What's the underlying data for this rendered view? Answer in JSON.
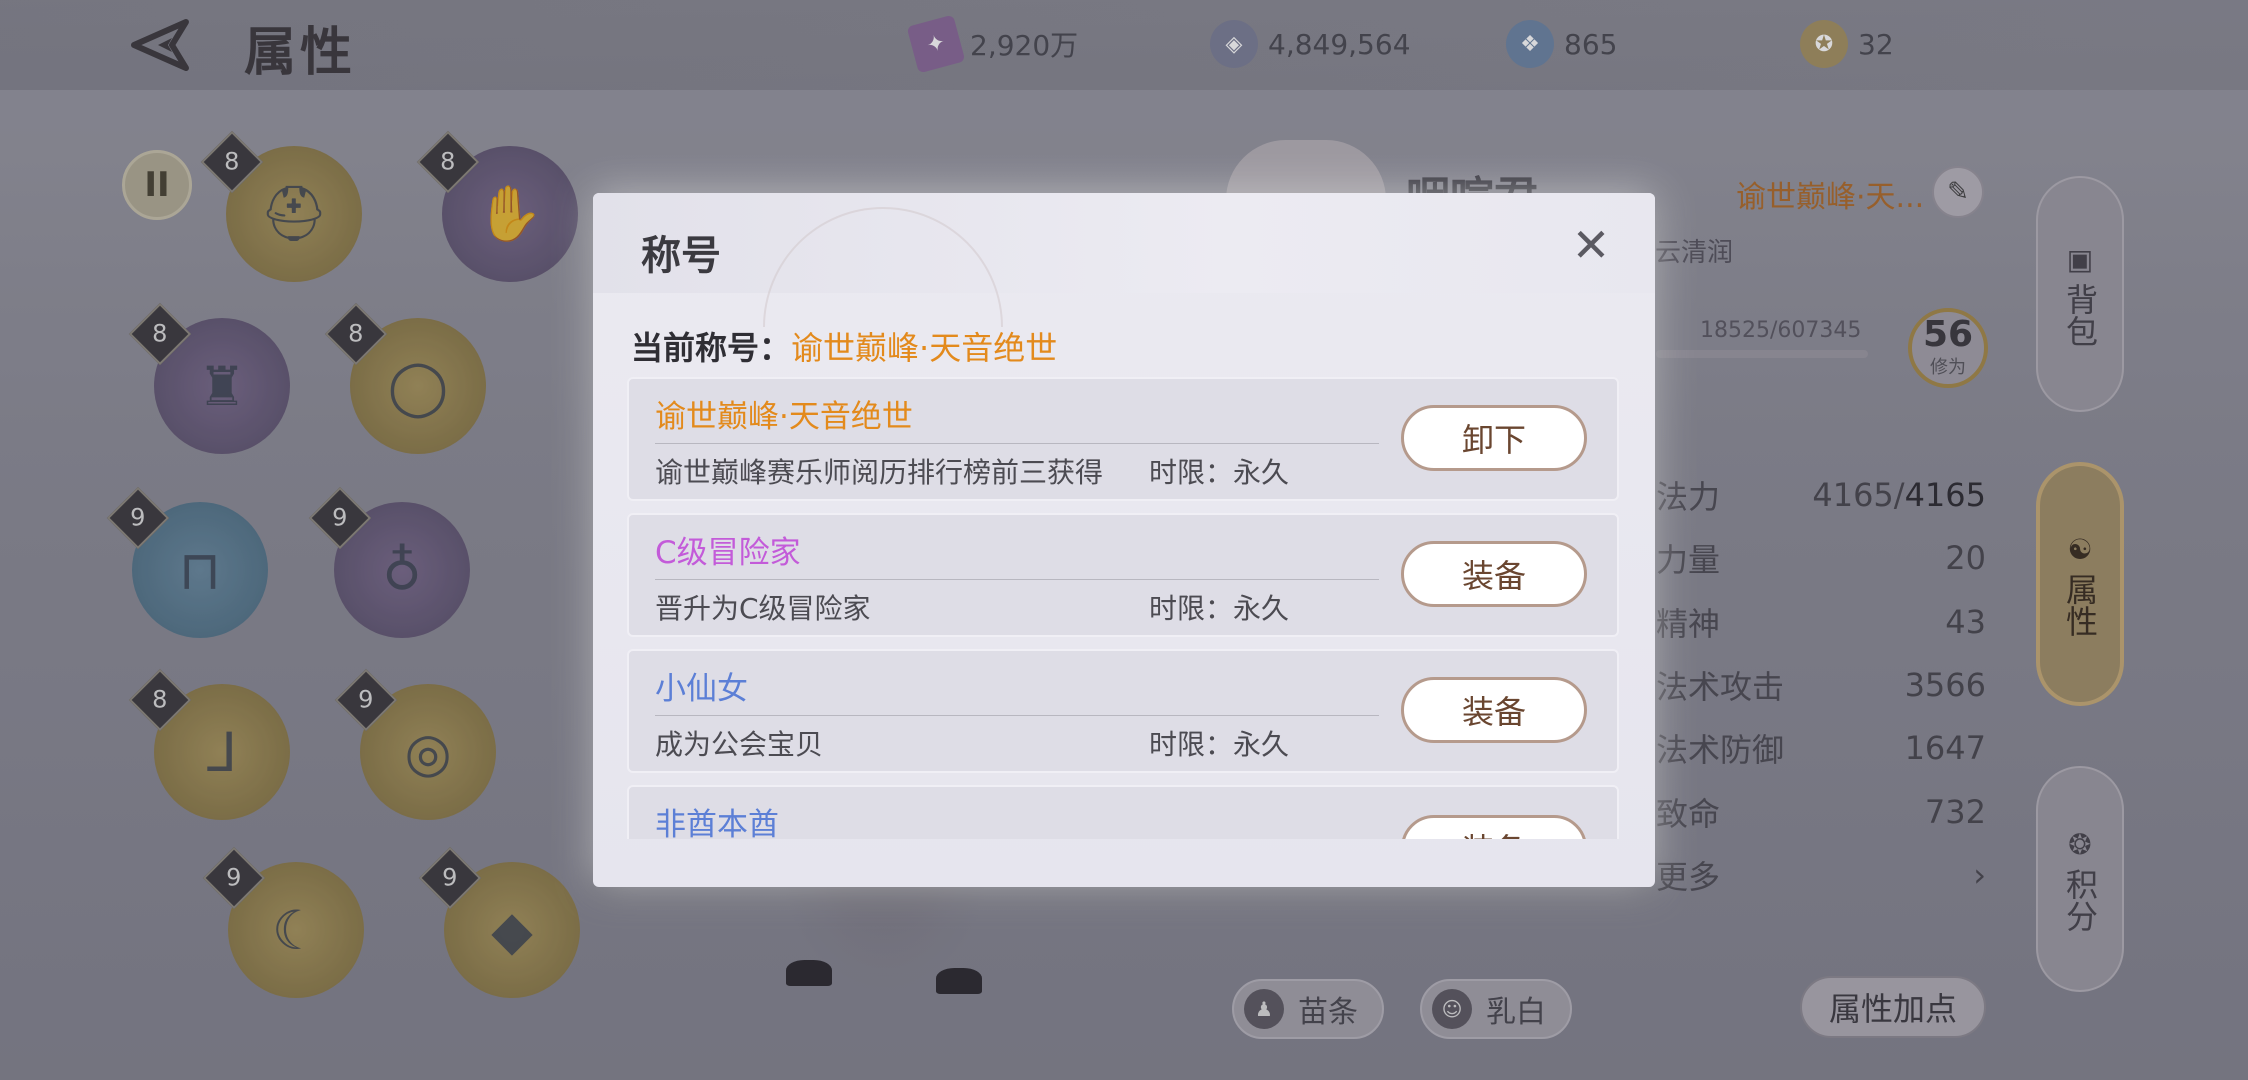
{
  "page": {
    "title": "属性"
  },
  "currencies": [
    {
      "icon": "gem-ticket-icon",
      "value": "2,920万"
    },
    {
      "icon": "silver-coin-icon",
      "value": "4,849,564"
    },
    {
      "icon": "blue-crystal-icon",
      "value": "865"
    },
    {
      "icon": "gold-medal-icon",
      "value": "32"
    }
  ],
  "pause_label": "II",
  "equipment_slots": [
    {
      "name": "helmet",
      "level": "8",
      "tier": "gold"
    },
    {
      "name": "gloves",
      "level": "8",
      "tier": "purple"
    },
    {
      "name": "armor",
      "level": "8",
      "tier": "purple"
    },
    {
      "name": "necklace",
      "level": "8",
      "tier": "gold"
    },
    {
      "name": "pants",
      "level": "9",
      "tier": "blue"
    },
    {
      "name": "earring",
      "level": "9",
      "tier": "purple"
    },
    {
      "name": "boots",
      "level": "8",
      "tier": "gold"
    },
    {
      "name": "ring",
      "level": "9",
      "tier": "gold"
    },
    {
      "name": "talisman",
      "level": "9",
      "tier": "gold"
    },
    {
      "name": "crystal",
      "level": "9",
      "tier": "gold"
    }
  ],
  "player": {
    "name": "咽喧君",
    "sub_label": "云清润",
    "title_link": "谕世巅峰·天...",
    "exp": "18525/607345",
    "level": "56",
    "level_caption": "修为"
  },
  "stats": [
    {
      "label": "法力",
      "value_a": "4165/",
      "value_b": "4165"
    },
    {
      "label": "力量",
      "value_a": "",
      "value_b": "20"
    },
    {
      "label": "精神",
      "value_a": "",
      "value_b": "43"
    },
    {
      "label": "法术攻击",
      "value_a": "",
      "value_b": "3566"
    },
    {
      "label": "法术防御",
      "value_a": "",
      "value_b": "1647"
    },
    {
      "label": "致命",
      "value_a": "",
      "value_b": "732"
    },
    {
      "label": "更多",
      "value_a": "",
      "value_b": "›"
    }
  ],
  "side_tabs": [
    {
      "label": "背包",
      "icon": "backpack-icon"
    },
    {
      "label": "属性",
      "icon": "attribute-icon"
    },
    {
      "label": "积分",
      "icon": "points-icon"
    }
  ],
  "bottom_buttons": {
    "body_type": "苗条",
    "skin_tone": "乳白",
    "attr_points": "属性加点"
  },
  "dialog": {
    "title": "称号",
    "current_label": "当前称号：",
    "current_value": "谕世巅峰·天音绝世",
    "items": [
      {
        "name": "谕世巅峰·天音绝世",
        "color": "#e38a1c",
        "desc": "谕世巅峰赛乐师阅历排行榜前三获得",
        "limit": "时限：永久",
        "button": "卸下"
      },
      {
        "name": "C级冒险家",
        "color": "#c35bd9",
        "desc": "晋升为C级冒险家",
        "limit": "时限：永久",
        "button": "装备"
      },
      {
        "name": "小仙女",
        "color": "#5c7fd6",
        "desc": "成为公会宝贝",
        "limit": "时限：永久",
        "button": "装备"
      },
      {
        "name": "非酋本酋",
        "color": "#5c7fd6",
        "desc": "",
        "limit": "",
        "button": "装备"
      }
    ]
  }
}
